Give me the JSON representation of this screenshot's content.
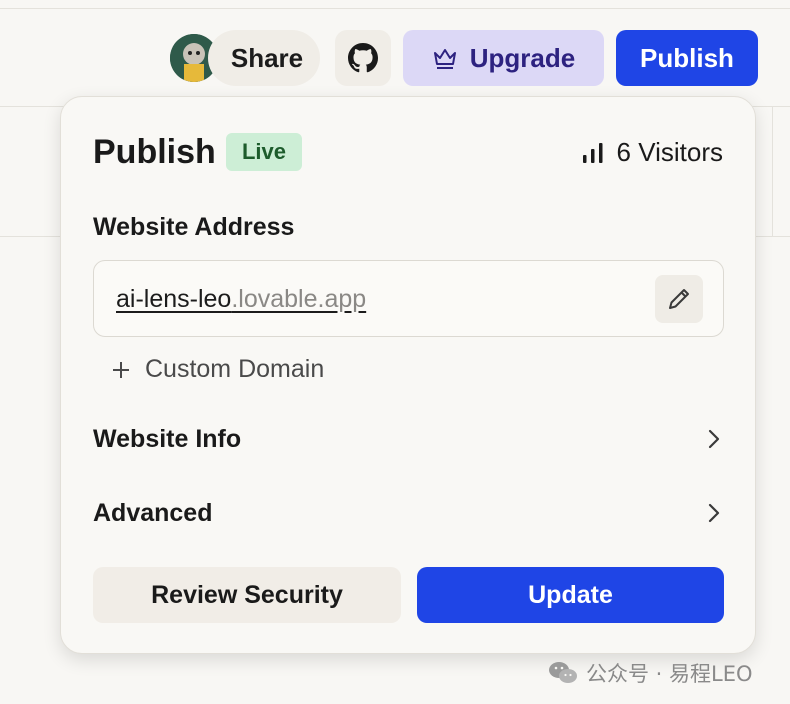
{
  "topbar": {
    "share_label": "Share",
    "upgrade_label": "Upgrade",
    "publish_label": "Publish"
  },
  "popover": {
    "title": "Publish",
    "status_badge": "Live",
    "visitors": "6 Visitors",
    "website_address_label": "Website Address",
    "address_subdomain": "ai-lens-leo",
    "address_domain": ".lovable.app",
    "custom_domain_label": "Custom Domain",
    "website_info_label": "Website Info",
    "advanced_label": "Advanced",
    "review_security_label": "Review Security",
    "update_label": "Update"
  },
  "watermark": {
    "text": "公众号 · 易程LEO"
  },
  "colors": {
    "accent": "#1f45e6",
    "upgrade_bg": "#dcd8f6",
    "live_bg": "#cdeed6",
    "live_text": "#1d5c2c"
  },
  "icons": [
    "avatar",
    "github-icon",
    "crown-icon",
    "bar-chart-icon",
    "pencil-icon",
    "plus-icon",
    "chevron-right-icon",
    "wechat-icon"
  ]
}
